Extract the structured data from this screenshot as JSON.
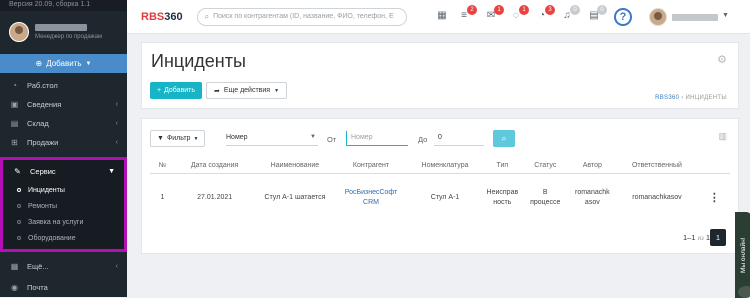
{
  "sidebar": {
    "version": "Версия 20.09, сборка 1.1",
    "user_role": "Менеджер по продажам",
    "add_label": "Добавить",
    "items_top": [
      {
        "label": "Раб.стол",
        "icon": "dashboard-icon"
      },
      {
        "label": "Сведения",
        "icon": "briefcase-icon"
      },
      {
        "label": "Склад",
        "icon": "car-icon"
      },
      {
        "label": "Продажи",
        "icon": "cart-icon"
      }
    ],
    "service": {
      "label": "Сервис",
      "subitems": [
        "Инциденты",
        "Ремонты",
        "Заявка на услуги",
        "Оборудование"
      ]
    },
    "items_bottom": [
      {
        "label": "Ещё...",
        "icon": "grid-icon"
      },
      {
        "label": "Почта",
        "icon": "mail-icon"
      }
    ]
  },
  "topbar": {
    "logo_main": "RBS",
    "logo_num": "360",
    "search_placeholder": "Поиск по контрагентам (ID, название, ФИО, телефон, E",
    "badges": [
      "2",
      "1",
      "1",
      "3",
      "0",
      "0"
    ],
    "help": "?"
  },
  "page": {
    "title": "Инциденты",
    "add_button": "Добавить",
    "more_button": "Еще действия",
    "breadcrumb_link": "RBS360",
    "breadcrumb_sep": "›",
    "breadcrumb_current": "ИНЦИДЕНТЫ"
  },
  "filter": {
    "button": "Фильтр",
    "field": "Номер",
    "from_label": "От",
    "from_placeholder": "Номер",
    "to_label": "До",
    "to_value": "0"
  },
  "table": {
    "headers": [
      "№",
      "Дата создания",
      "Наименование",
      "Контрагент",
      "Номенклатура",
      "Тип",
      "Статус",
      "Автор",
      "Ответственный"
    ],
    "rows": [
      {
        "num": "1",
        "date": "27.01.2021",
        "name": "Стул А-1 шатается",
        "counterparty": "РосБизнесСофт CRM",
        "nomenclature": "Стул А-1",
        "type": "Неисправность",
        "status": "В процессе",
        "author": "romanachkasov",
        "responsible": "romanachkasov"
      }
    ]
  },
  "pager": {
    "range": "1–1",
    "of_label": "из",
    "total": "1",
    "page": "1"
  },
  "online_widget": "Мы онлайн!"
}
